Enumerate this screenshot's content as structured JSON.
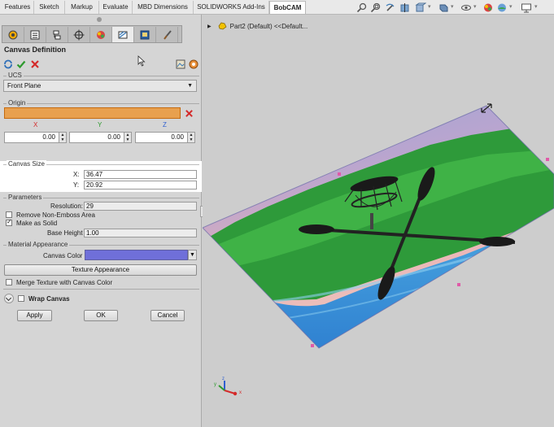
{
  "menu_tabs": [
    "Features",
    "Sketch",
    "Markup",
    "Evaluate",
    "MBD Dimensions",
    "SOLIDWORKS Add-Ins",
    "BobCAM"
  ],
  "active_tab": "BobCAM",
  "view_toolbar_icons": [
    "search-icon",
    "zoom-area-icon",
    "previous-view-icon",
    "section-view-icon",
    "view-orientation-icon",
    "display-style-icon",
    "hide-show-icon",
    "edit-appearance-icon",
    "apply-scene-icon",
    "view-settings-icon"
  ],
  "panel": {
    "tab_icons": [
      "featuremanager-icon",
      "propertymanager-icon",
      "configurationmanager-icon",
      "dimxpert-icon",
      "display-manager-icon",
      "bobcam-tree-icon",
      "bobcam-machine-icon",
      "paint-brush-icon"
    ],
    "title": "Canvas Definition",
    "ucs": {
      "label": "UCS",
      "selected": "Front Plane"
    },
    "origin": {
      "label": "Origin",
      "axes": [
        "X",
        "Y",
        "Z"
      ],
      "values": [
        "0.00",
        "0.00",
        "0.00"
      ]
    },
    "canvas_size": {
      "label": "Canvas Size",
      "x_label": "X:",
      "x_value": "36.47",
      "y_label": "Y:",
      "y_value": "20.92"
    },
    "parameters": {
      "label": "Parameters",
      "resolution_label": "Resolution:",
      "resolution_value": "29",
      "remove_non_emboss": "Remove Non-Emboss Area",
      "make_as_solid": "Make as Solid",
      "base_height_label": "Base Height",
      "base_height_value": "1.00"
    },
    "material": {
      "label": "Material Appearance",
      "canvas_color_label": "Canvas Color",
      "canvas_color": "#6f6fd9",
      "texture_button": "Texture Appearance",
      "merge_texture": "Merge Texture with Canvas Color"
    },
    "wrap_canvas": "Wrap Canvas",
    "buttons": {
      "apply": "Apply",
      "ok": "OK",
      "cancel": "Cancel"
    }
  },
  "tree": {
    "part": "Part2 (Default) <<Default..."
  },
  "colors": {
    "accent": "#e8a04e",
    "tab_active_bg": "#ffffff",
    "panel_bg": "#d5d5d5",
    "viewport_bg": "#cdcdcd"
  }
}
